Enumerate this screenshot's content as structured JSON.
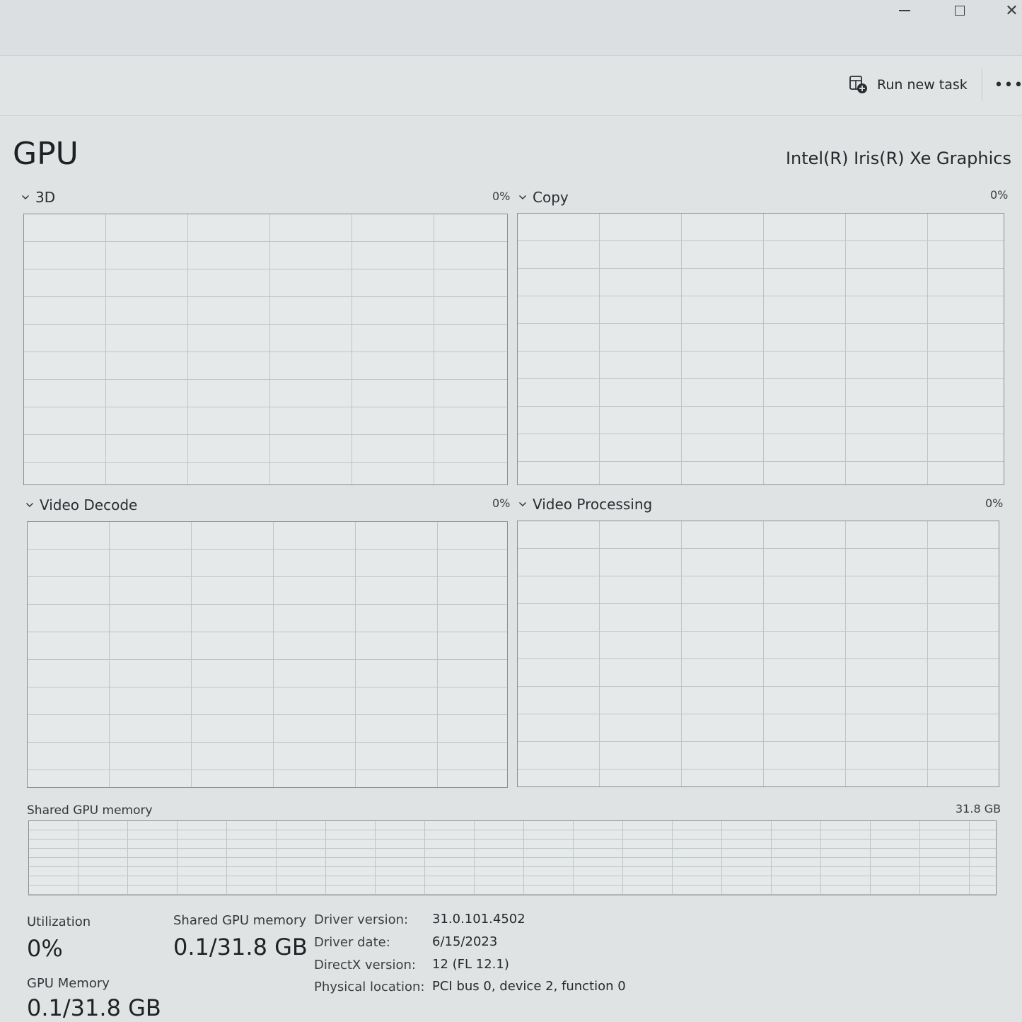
{
  "toolbar": {
    "run_new_task": "Run new task",
    "more": "•••"
  },
  "header": {
    "title": "GPU",
    "adapter_name": "Intel(R) Iris(R) Xe Graphics"
  },
  "engines": [
    {
      "label": "3D",
      "percent": "0%"
    },
    {
      "label": "Copy",
      "percent": "0%"
    },
    {
      "label": "Video Decode",
      "percent": "0%"
    },
    {
      "label": "Video Processing",
      "percent": "0%"
    }
  ],
  "shared_memory_graph": {
    "label": "Shared GPU memory",
    "max": "31.8 GB"
  },
  "stats": {
    "utilization_label": "Utilization",
    "utilization_value": "0%",
    "shared_memory_label": "Shared GPU memory",
    "shared_memory_value": "0.1/31.8 GB",
    "gpu_memory_label": "GPU Memory",
    "gpu_memory_value": "0.1/31.8 GB"
  },
  "details": [
    {
      "key": "Driver version:",
      "value": "31.0.101.4502"
    },
    {
      "key": "Driver date:",
      "value": "6/15/2023"
    },
    {
      "key": "DirectX version:",
      "value": "12 (FL 12.1)"
    },
    {
      "key": "Physical location:",
      "value": "PCI bus 0, device 2, function 0"
    }
  ]
}
